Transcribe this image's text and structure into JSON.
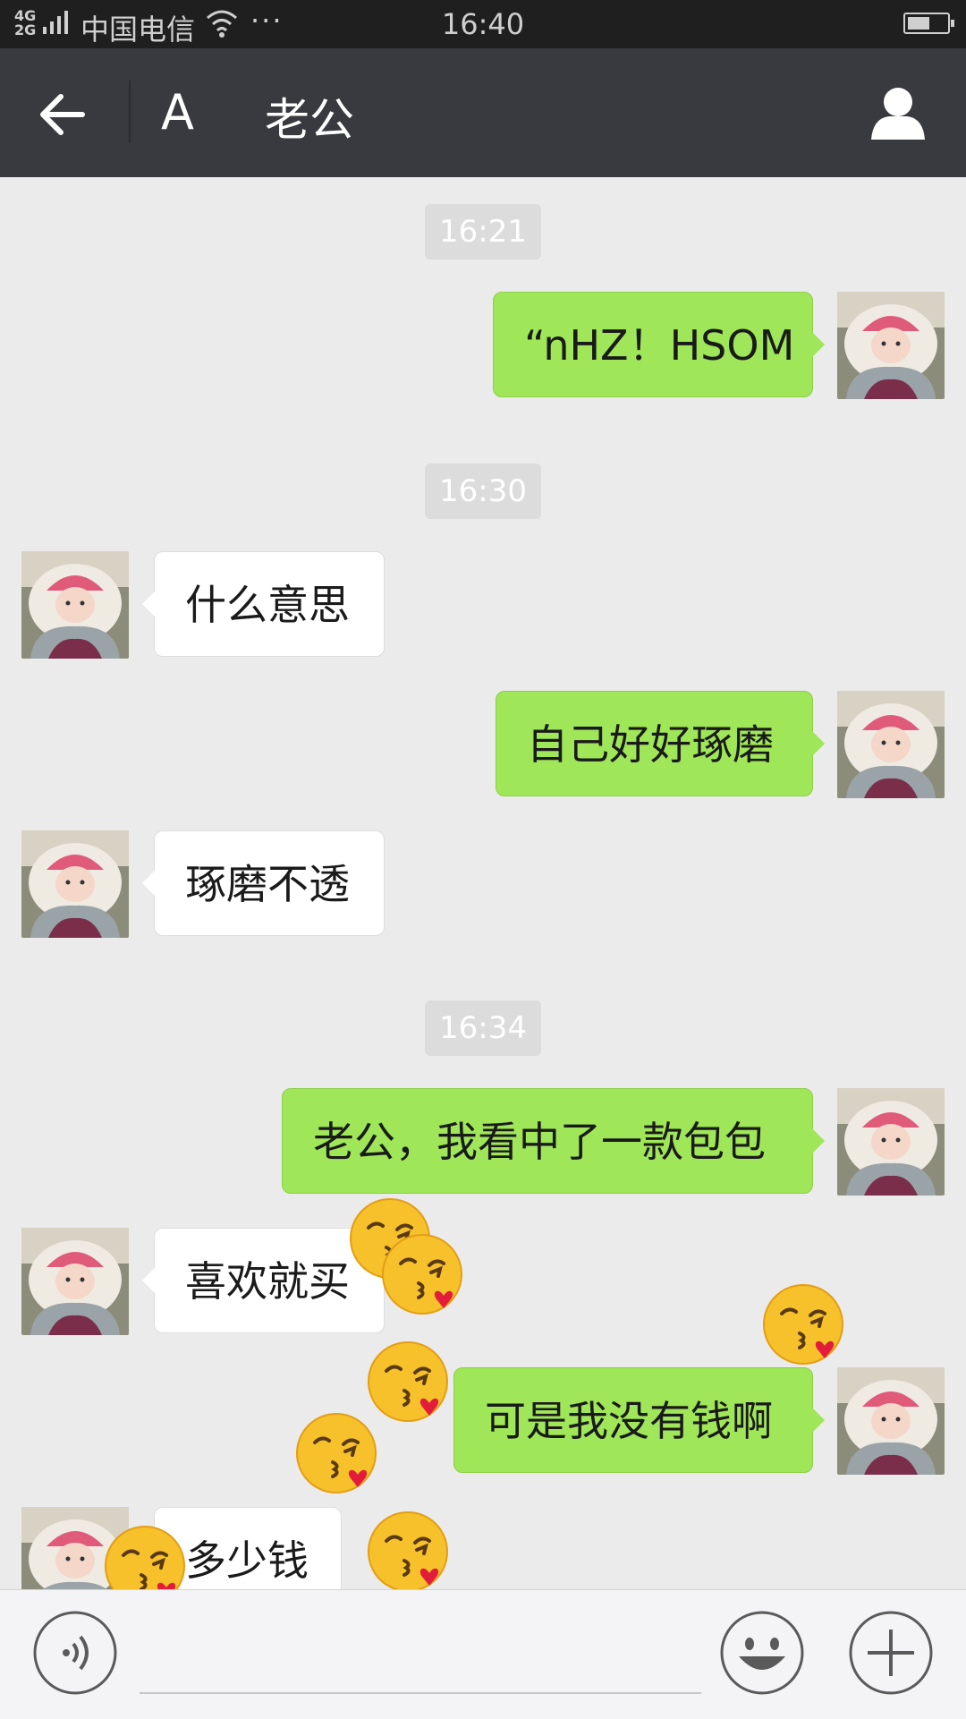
{
  "status_bar": {
    "network": "4G 2G",
    "carrier": "中国电信",
    "more": "···",
    "time": "16:40"
  },
  "header": {
    "title_prefix": "A",
    "title": "老公",
    "back_icon": "arrow-left-icon",
    "profile_icon": "person-icon",
    "color": "#393a3f"
  },
  "messages": [
    {
      "type": "time",
      "text": "16:21"
    },
    {
      "type": "msg",
      "from": "self",
      "text": "“nHZ！HSOM"
    },
    {
      "type": "time",
      "text": "16:30"
    },
    {
      "type": "msg",
      "from": "other",
      "text": "什么意思"
    },
    {
      "type": "msg",
      "from": "self",
      "text": "自己好好琢磨"
    },
    {
      "type": "msg",
      "from": "other",
      "text": "琢磨不透"
    },
    {
      "type": "time",
      "text": "16:34"
    },
    {
      "type": "msg",
      "from": "self",
      "text": "老公，我看中了一款包包"
    },
    {
      "type": "msg",
      "from": "other",
      "text": "喜欢就买"
    },
    {
      "type": "msg",
      "from": "self",
      "text": "可是我没有钱啊"
    },
    {
      "type": "msg",
      "from": "other",
      "text": "多少钱"
    }
  ],
  "emoji": "face-blowing-kiss-icon",
  "input_bar": {
    "voice_icon": "voice-icon",
    "emoji_icon": "smiley-icon",
    "more_icon": "plus-icon",
    "input_value": ""
  },
  "colors": {
    "self_bubble": "#9fe658",
    "other_bubble": "#ffffff",
    "background": "#ebebeb"
  }
}
